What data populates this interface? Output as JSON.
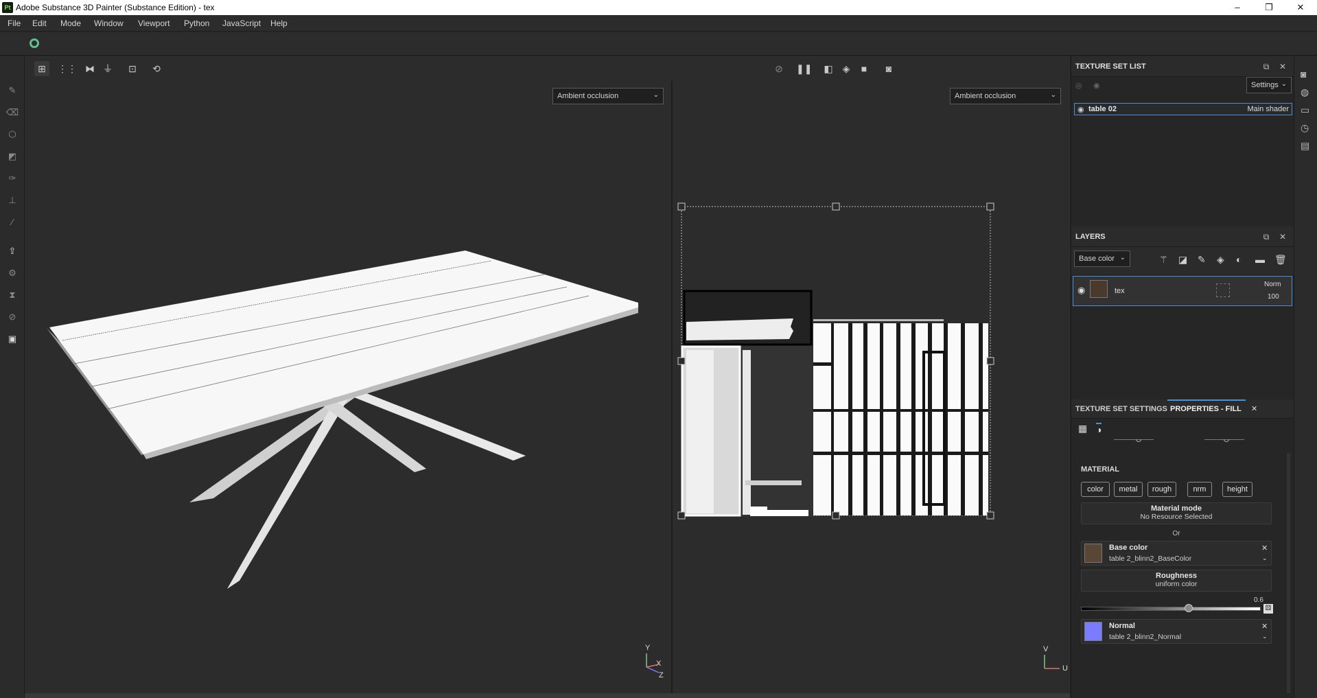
{
  "window": {
    "icon_text": "Pt",
    "title": "Adobe Substance 3D Painter (Substance Edition) - tex",
    "minimize": "–",
    "maximize": "❐",
    "close": "✕"
  },
  "menu": [
    "File",
    "Edit",
    "Mode",
    "Window",
    "Viewport",
    "Python",
    "JavaScript",
    "Help"
  ],
  "viewport": {
    "left_channel": "Ambient occlusion",
    "right_channel": "Ambient occlusion",
    "axis_3d": {
      "y": "Y",
      "x": "X",
      "z": "Z"
    },
    "axis_uv": {
      "v": "V",
      "u": "U"
    }
  },
  "texture_set_list": {
    "title": "TEXTURE SET LIST",
    "settings_label": "Settings",
    "item": {
      "name": "table 02",
      "shader": "Main shader"
    }
  },
  "layers": {
    "title": "LAYERS",
    "channel": "Base color",
    "layer": {
      "name": "tex",
      "blend": "Norm",
      "opacity": "100"
    }
  },
  "properties": {
    "tab_settings": "TEXTURE SET SETTINGS",
    "tab_fill": "PROPERTIES - FILL",
    "section": "MATERIAL",
    "chips": [
      "color",
      "metal",
      "rough",
      "nrm",
      "height"
    ],
    "material_mode": {
      "title": "Material mode",
      "value": "No Resource Selected"
    },
    "or_label": "Or",
    "base_color": {
      "title": "Base color",
      "value": "table 2_blinn2_BaseColor"
    },
    "roughness": {
      "title": "Roughness",
      "value": "uniform color",
      "number": "0.6",
      "level": 0.6
    },
    "normal": {
      "title": "Normal",
      "value": "table 2_blinn2_Normal"
    }
  },
  "colors": {
    "accent": "#4a90d9",
    "normal_swatch": "#7b7bff"
  }
}
